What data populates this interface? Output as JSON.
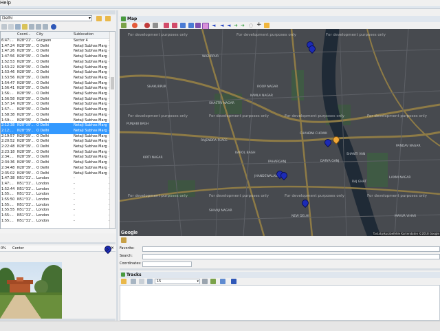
{
  "menu": {
    "help_label": "Help"
  },
  "folder": {
    "current": "Delhi"
  },
  "grid": {
    "columns": [
      "",
      "Coord...",
      "City",
      "Sublocation",
      ""
    ],
    "rows": [
      {
        "time": "6:47:...",
        "coord": "N28°21'...",
        "city": "Gurgaon",
        "sub": "Sector 4"
      },
      {
        "time": "1:47:24",
        "coord": "N28°39'...",
        "city": "Ö Delhi",
        "sub": "Netaji Subhas Marg"
      },
      {
        "time": "1:47:26",
        "coord": "N28°39'...",
        "city": "Ö Delhi",
        "sub": "Netaji Subhas Marg"
      },
      {
        "time": "1:47:56",
        "coord": "N28°39'...",
        "city": "Ö Delhi",
        "sub": "Netaji Subhas Marg"
      },
      {
        "time": "1:52:53",
        "coord": "N28°39'...",
        "city": "Ö Delhi",
        "sub": "Netaji Subhas Marg"
      },
      {
        "time": "1:53:22",
        "coord": "N28°39'...",
        "city": "Ö Delhi",
        "sub": "Netaji Subhas Marg"
      },
      {
        "time": "1:53:46",
        "coord": "N28°39'...",
        "city": "Ö Delhi",
        "sub": "Netaji Subhas Marg"
      },
      {
        "time": "1:53:56",
        "coord": "N28°39'...",
        "city": "Ö Delhi",
        "sub": "Netaji Subhas Marg"
      },
      {
        "time": "1:54:47",
        "coord": "N28°39'...",
        "city": "Ö Delhi",
        "sub": "Netaji Subhas Marg"
      },
      {
        "time": "1:56:41",
        "coord": "N28°39'...",
        "city": "Ö Delhi",
        "sub": "Netaji Subhas Marg"
      },
      {
        "time": "1:56:...",
        "coord": "N28°39'...",
        "city": "Ö Delhi",
        "sub": "Netaji Subhas Marg"
      },
      {
        "time": "1:56:58",
        "coord": "N28°39'...",
        "city": "Ö Delhi",
        "sub": "Netaji Subhas Marg"
      },
      {
        "time": "1:57:14",
        "coord": "N28°39'...",
        "city": "Ö Delhi",
        "sub": "Netaji Subhas Marg"
      },
      {
        "time": "1:57:...",
        "coord": "N28°39'...",
        "city": "Ö Delhi",
        "sub": "Netaji Subhas Marg"
      },
      {
        "time": "1:58:38",
        "coord": "N28°39'...",
        "city": "Ö Delhi",
        "sub": "Netaji Subhas Marg"
      },
      {
        "time": "1:59:...",
        "coord": "N28°39'...",
        "city": "Ö Delhi",
        "sub": "Netaji Subhas Marg"
      },
      {
        "time": "2:12:38",
        "coord": "N28°39'...",
        "city": "Ö Delhi",
        "sub": "Netaji Subhas Marg"
      },
      {
        "time": "2:12:...",
        "coord": "N28°39'...",
        "city": "Ö Delhi",
        "sub": "Netaji Subhas Marg"
      },
      {
        "time": "2:19:57",
        "coord": "N28°39'...",
        "city": "Ö Delhi",
        "sub": "Netaji Subhas Marg"
      },
      {
        "time": "2:20:52",
        "coord": "N28°39'...",
        "city": "Ö Delhi",
        "sub": "Netaji Subhas Marg"
      },
      {
        "time": "2:22:48",
        "coord": "N28°39'...",
        "city": "Ö Delhi",
        "sub": "Netaji Subhas Marg"
      },
      {
        "time": "2:23:18",
        "coord": "N28°39'...",
        "city": "Ö Delhi",
        "sub": "Netaji Subhas Marg"
      },
      {
        "time": "2:34:...",
        "coord": "N28°39'...",
        "city": "Ö Delhi",
        "sub": "Netaji Subhas Marg"
      },
      {
        "time": "2:34:36",
        "coord": "N28°39'...",
        "city": "Ö Delhi",
        "sub": "Netaji Subhas Marg"
      },
      {
        "time": "2:34:48",
        "coord": "N28°39'...",
        "city": "Ö Delhi",
        "sub": "Netaji Subhas Marg"
      },
      {
        "time": "2:35:02",
        "coord": "N28°39'...",
        "city": "Ö Delhi",
        "sub": "Netaji Subhas Marg"
      },
      {
        "time": "1:47:38",
        "coord": "N51°31'...",
        "city": "London",
        "sub": "-"
      },
      {
        "time": "1:47:...",
        "coord": "N51°31'...",
        "city": "London",
        "sub": "-"
      },
      {
        "time": "1:52:44",
        "coord": "N51°31'...",
        "city": "London",
        "sub": "-"
      },
      {
        "time": "1:55:...",
        "coord": "N51°31'...",
        "city": "London",
        "sub": "-"
      },
      {
        "time": "1:55:50",
        "coord": "N51°31'...",
        "city": "London",
        "sub": "-"
      },
      {
        "time": "1:55:...",
        "coord": "N51°31'...",
        "city": "London",
        "sub": "-"
      },
      {
        "time": "1:55:55",
        "coord": "N51°31'...",
        "city": "London",
        "sub": "-"
      },
      {
        "time": "1:55:...",
        "coord": "N51°31'...",
        "city": "London",
        "sub": "-"
      },
      {
        "time": "1:55:...",
        "coord": "N51°31'...",
        "city": "London",
        "sub": "-"
      }
    ],
    "selected_rows": [
      16,
      17
    ]
  },
  "image_panel": {
    "zoom": "0%",
    "mode": "Center"
  },
  "map": {
    "title": "Map",
    "watermark": "For development purposes only",
    "attribution": "Tastaturkurzbefehle  Kartendaten ©2018 Google",
    "logo": "Google",
    "places": [
      "WAZIRPUR",
      "SHAKURPUR",
      "KAMLA NAGAR",
      "ROOP NAGAR",
      "SHASTRI NAGAR",
      "PUNJABI BAGH",
      "KIRTI NAGAR",
      "KAROL BAGH",
      "PAHARGANJ",
      "RAJENDRA PLACE",
      "JHANDEWALAN",
      "SHIVAJI NAGAR",
      "DARYA GANJ",
      "SHANTI VAN",
      "RAJ GHAT",
      "PANDAV NAGAR",
      "MAYUR VIHAR",
      "LAXMI NAGAR",
      "NEW DELHI",
      "CHANDNI CHOWK"
    ]
  },
  "form": {
    "favorite_label": "Favorite:",
    "search_label": "Search:",
    "coordinates_label": "Coordinates:"
  },
  "tracks": {
    "title": "Tracks",
    "select_value": "15"
  },
  "colors": {
    "selection": "#3399ff",
    "pin": "#1c2bb5",
    "panel_header": "#dfe6ee"
  }
}
